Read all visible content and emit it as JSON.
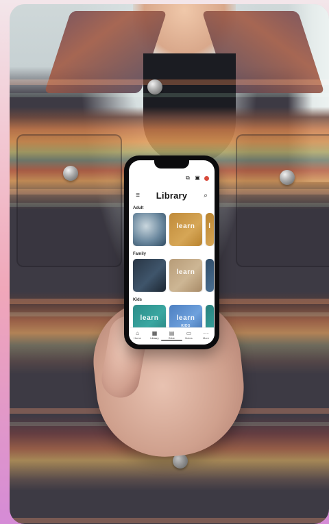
{
  "phone": {
    "title": "Library",
    "sections": [
      {
        "label": "Adult",
        "tiles": [
          {
            "kind": "wave",
            "text": "",
            "sub": ""
          },
          {
            "kind": "learn-gold",
            "text": "learn",
            "sub": ""
          },
          {
            "kind": "partial-gold",
            "text": "l",
            "sub": ""
          }
        ]
      },
      {
        "label": "Family",
        "tiles": [
          {
            "kind": "photo-dark",
            "text": "",
            "sub": ""
          },
          {
            "kind": "learn-beige",
            "text": "learn",
            "sub": ""
          },
          {
            "kind": "partial-blue",
            "text": "",
            "sub": ""
          }
        ]
      },
      {
        "label": "Kids",
        "tiles": [
          {
            "kind": "kids-teal",
            "text": "learn",
            "sub": ""
          },
          {
            "kind": "kids-blue",
            "text": "learn",
            "sub": "KIDS"
          },
          {
            "kind": "partial-teal",
            "text": "",
            "sub": ""
          }
        ]
      }
    ],
    "tabs": [
      {
        "label": "Home",
        "icon": "home-icon"
      },
      {
        "label": "Library",
        "icon": "library-icon"
      },
      {
        "label": "Bible",
        "icon": "bible-icon"
      },
      {
        "label": "Notes",
        "icon": "notes-icon"
      },
      {
        "label": "More",
        "icon": "more-icon"
      }
    ]
  },
  "colors": {
    "background_gradient_top": "#f3e6ea",
    "background_gradient_bottom": "#d58bd6",
    "phone_frame": "#0b0b0d",
    "notification_red": "#d84b3c"
  }
}
